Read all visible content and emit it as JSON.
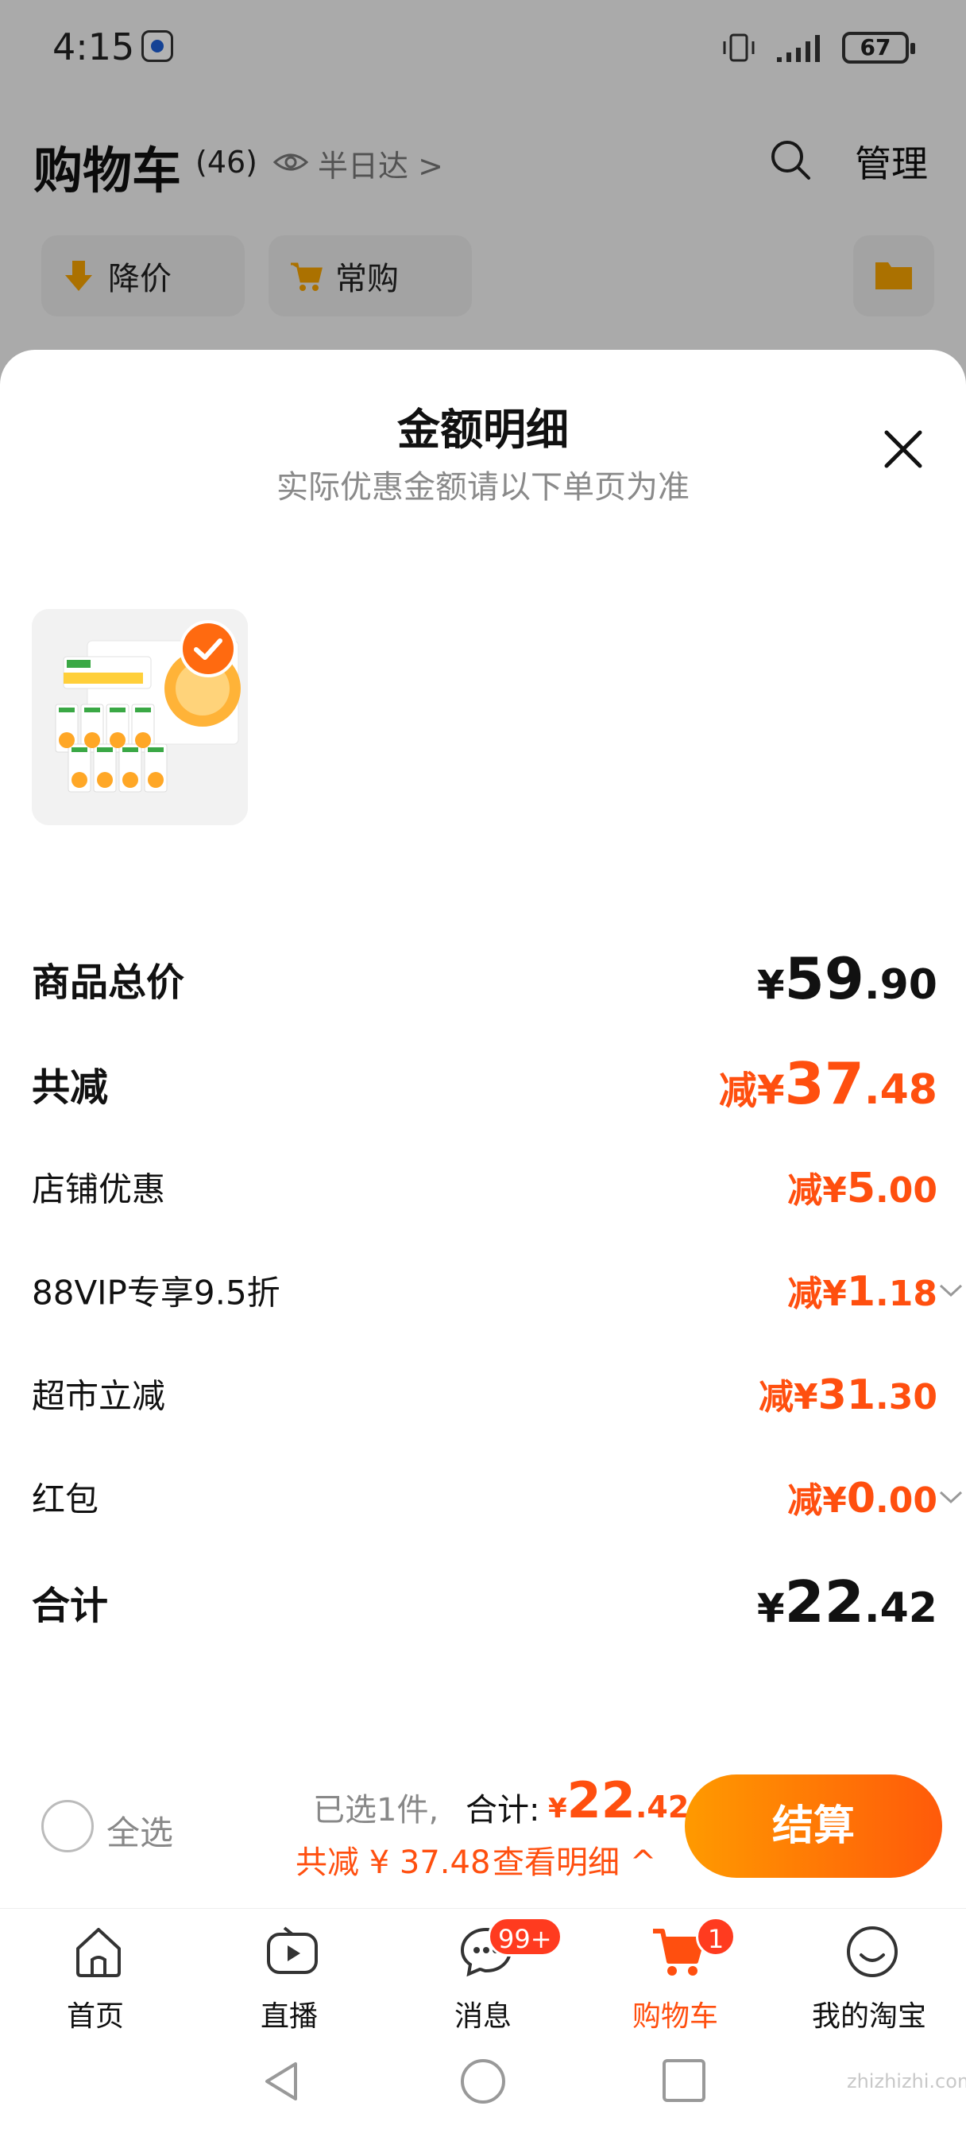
{
  "statusbar": {
    "time": "4:15",
    "battery": "67"
  },
  "header": {
    "title": "购物车",
    "count": "(46)",
    "delivery": "半日达 >",
    "manage": "管理"
  },
  "chips": [
    {
      "label": "降价"
    },
    {
      "label": "常购"
    }
  ],
  "sheet": {
    "title": "金额明细",
    "subtitle": "实际优惠金额请以下单页为准",
    "rows": [
      {
        "label": "商品总价",
        "prefix": "",
        "sym": "¥",
        "int": "59",
        "dec": ".90"
      },
      {
        "label": "共减",
        "prefix": "减",
        "sym": "¥",
        "int": "37",
        "dec": ".48"
      },
      {
        "label": "店铺优惠",
        "prefix": "减",
        "sym": "¥",
        "int": "5",
        "dec": ".00"
      },
      {
        "label": "88VIP专享9.5折",
        "prefix": "减",
        "sym": "¥",
        "int": "1",
        "dec": ".18"
      },
      {
        "label": "超市立减",
        "prefix": "减",
        "sym": "¥",
        "int": "31",
        "dec": ".30"
      },
      {
        "label": "红包",
        "prefix": "减",
        "sym": "¥",
        "int": "0",
        "dec": ".00"
      },
      {
        "label": "合计",
        "prefix": "",
        "sym": "¥",
        "int": "22",
        "dec": ".42"
      }
    ]
  },
  "checkout": {
    "select_all": "全选",
    "selected": "已选1件,",
    "total_label": "合计:",
    "total_sym": "¥",
    "total_int": "22",
    "total_dec": ".42",
    "saved": "共减 ¥ 37.48",
    "view_detail": "查看明细 ^",
    "button": "结算"
  },
  "tabs": [
    {
      "label": "首页",
      "icon": "home-icon"
    },
    {
      "label": "直播",
      "icon": "live-icon"
    },
    {
      "label": "消息",
      "icon": "message-icon",
      "badge": "99+"
    },
    {
      "label": "购物车",
      "icon": "cart-icon",
      "badge": "1"
    },
    {
      "label": "我的淘宝",
      "icon": "profile-icon"
    }
  ],
  "watermark": "zhizhizhi.com",
  "colors": {
    "accent": "#ff4f0f",
    "button_start": "#ff9a00",
    "button_end": "#ff5a0a",
    "badge": "#ff3b1f"
  }
}
